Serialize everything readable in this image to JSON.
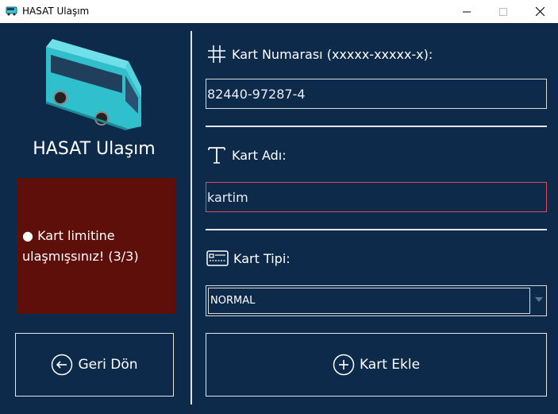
{
  "window": {
    "title": "HASAT Ulaşım",
    "app_icon": "bus-icon"
  },
  "sidebar": {
    "brand": "HASAT Ulaşım",
    "alert_bullet": "●",
    "alert_text": "Kart limitine ulaşmışsınız! (3/3)",
    "back_button": "Geri Dön",
    "colors": {
      "alert_bg": "#5f0f0a",
      "bg": "#0e2a4a"
    }
  },
  "form": {
    "card_number_label": "Kart Numarası (xxxxx-xxxxx-x):",
    "card_number_value": "82440-97287-4",
    "card_name_label": "Kart Adı:",
    "card_name_value": "kartim",
    "card_type_label": "Kart Tipi:",
    "card_type_selected": "NORMAL",
    "add_button": "Kart Ekle",
    "colors": {
      "error_border": "#d94c62"
    }
  }
}
